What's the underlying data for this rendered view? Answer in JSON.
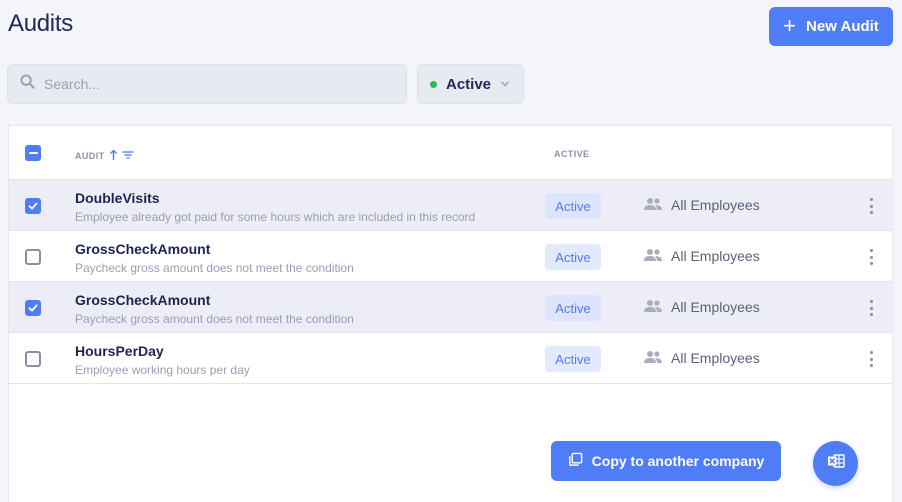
{
  "page": {
    "title": "Audits"
  },
  "toolbar": {
    "new_audit_label": "New Audit"
  },
  "search": {
    "placeholder": "Search...",
    "value": ""
  },
  "filter": {
    "selected": "Active",
    "status_color": "#2db84c"
  },
  "table": {
    "columns": {
      "audit": "AUDIT",
      "active": "ACTIVE"
    },
    "sort": {
      "column": "audit",
      "direction": "ascending"
    },
    "rows": [
      {
        "name": "DoubleVisits",
        "description": "Employee already got paid for some hours which are included in this record",
        "status": "Active",
        "scope": "All Employees",
        "selected": true
      },
      {
        "name": "GrossCheckAmount",
        "description": "Paycheck gross amount does not meet the condition",
        "status": "Active",
        "scope": "All Employees",
        "selected": false
      },
      {
        "name": "GrossCheckAmount",
        "description": "Paycheck gross amount does not meet the condition",
        "status": "Active",
        "scope": "All Employees",
        "selected": true
      },
      {
        "name": "HoursPerDay",
        "description": "Employee working hours per day",
        "status": "Active",
        "scope": "All Employees",
        "selected": false
      }
    ]
  },
  "actions": {
    "copy_label": "Copy to another company",
    "export_icon": "excel-icon"
  },
  "colors": {
    "accent": "#4f7cf7",
    "selected_row": "#ecedf6",
    "badge_bg": "#e3eafd"
  }
}
